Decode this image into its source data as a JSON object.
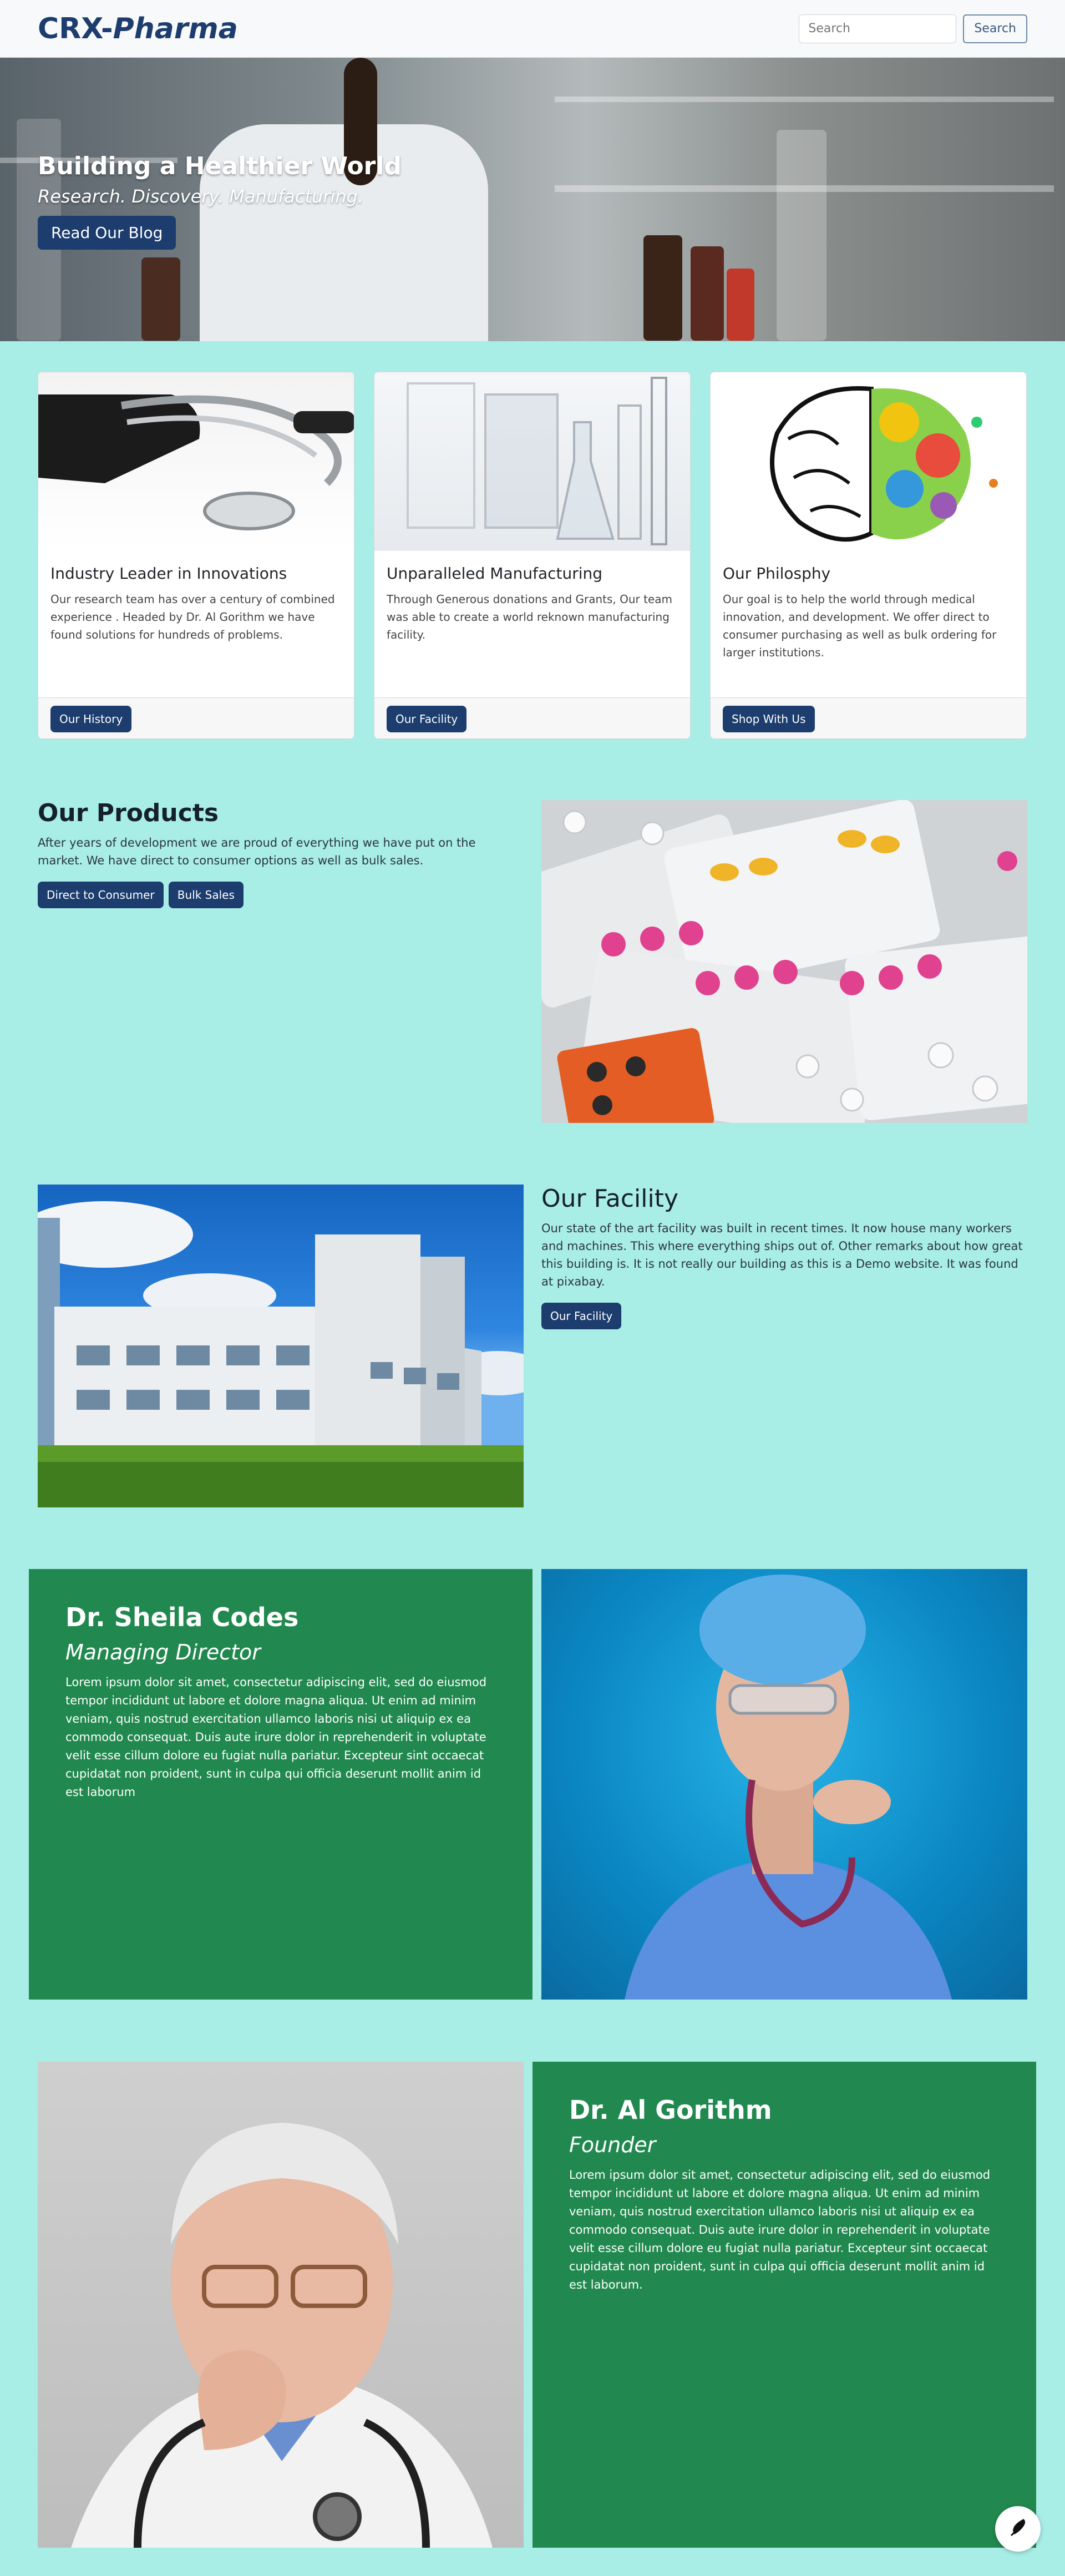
{
  "nav": {
    "brand_a": "CRX-",
    "brand_b": "Pharma",
    "search_placeholder": "Search",
    "search_button": "Search"
  },
  "hero": {
    "title": "Building a Healthier World",
    "subtitle": "Research. Discovery. Manufacturing.",
    "button": "Read Our Blog"
  },
  "cards": [
    {
      "title": "Industry Leader in Innovations",
      "text": "Our research team has over a century of combined experience . Headed by Dr. Al Gorithm we have found solutions for hundreds of problems.",
      "button": "Our History"
    },
    {
      "title": "Unparalleled Manufacturing",
      "text": "Through Generous donations and Grants, Our team was able to create a world reknown manufacturing facility.",
      "button": "Our Facility"
    },
    {
      "title": "Our Philosphy",
      "text": "Our goal is to help the world through medical innovation, and development. We offer direct to consumer purchasing as well as bulk ordering for larger institutions.",
      "button": "Shop With Us"
    }
  ],
  "products": {
    "title": "Our Products",
    "text": "After years of development we are proud of everything we have put on the market. We have direct to consumer options as well as bulk sales.",
    "button_direct": "Direct to Consumer",
    "button_bulk": "Bulk Sales"
  },
  "facility": {
    "title": "Our Facility",
    "text": "Our state of the art facility was built in recent times. It now house many workers and machines. This where everything ships out of. Other remarks about how great this building is. It is not really our building as this is a Demo website. It was found at pixabay.",
    "button": "Our Facility"
  },
  "team": [
    {
      "name": "Dr. Sheila Codes",
      "role": "Managing Director",
      "bio": "Lorem ipsum dolor sit amet, consectetur adipiscing elit, sed do eiusmod tempor incididunt ut labore et dolore magna aliqua. Ut enim ad minim veniam, quis nostrud exercitation ullamco laboris nisi ut aliquip ex ea commodo consequat. Duis aute irure dolor in reprehenderit in voluptate velit esse cillum dolore eu fugiat nulla pariatur. Excepteur sint occaecat cupidatat non proident, sunt in culpa qui officia deserunt mollit anim id est laborum"
    },
    {
      "name": "Dr. Al Gorithm",
      "role": "Founder",
      "bio": "Lorem ipsum dolor sit amet, consectetur adipiscing elit, sed do eiusmod tempor incididunt ut labore et dolore magna aliqua. Ut enim ad minim veniam, quis nostrud exercitation ullamco laboris nisi ut aliquip ex ea commodo consequat. Duis aute irure dolor in reprehenderit in voluptate velit esse cillum dolore eu fugiat nulla pariatur. Excepteur sint occaecat cupidatat non proident, sunt in culpa qui officia deserunt mollit anim id est laborum."
    }
  ],
  "icons": {
    "fab": "quill-icon"
  },
  "colors": {
    "page_background": "#a8ede6",
    "brand_blue": "#1c3d6e",
    "team_panel_green": "#21894f"
  }
}
